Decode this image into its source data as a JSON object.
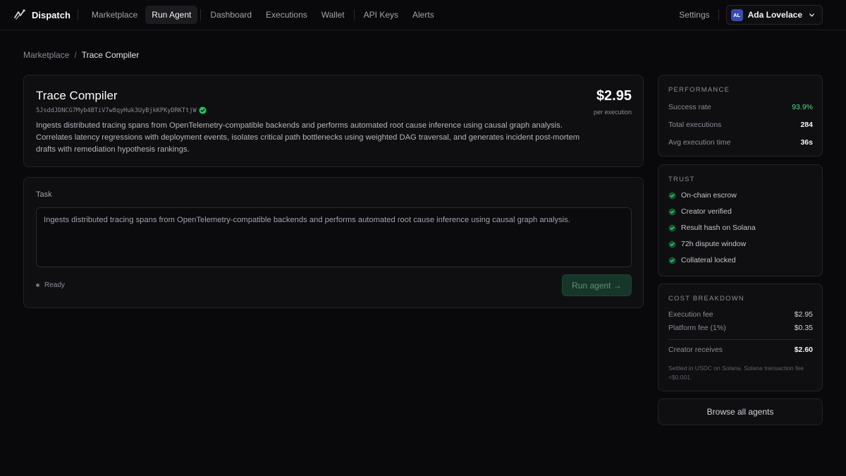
{
  "brand": {
    "name": "Dispatch"
  },
  "nav": {
    "items": [
      "Marketplace",
      "Run Agent",
      "Dashboard",
      "Executions",
      "Wallet",
      "API Keys",
      "Alerts"
    ],
    "active": "Run Agent",
    "settings": "Settings",
    "user": {
      "initials": "AL",
      "name": "Ada Lovelace"
    }
  },
  "breadcrumb": {
    "parent": "Marketplace",
    "separator": "/",
    "current": "Trace Compiler"
  },
  "agent": {
    "title": "Trace Compiler",
    "address": "5JsddJDNCG7Myb4BTiV7w8qyHuk3UyBjkKPKyDRKTtjW",
    "description": "Ingests distributed tracing spans from OpenTelemetry-compatible backends and performs automated root cause inference using causal graph analysis. Correlates latency regressions with deployment events, isolates critical path bottlenecks using weighted DAG traversal, and generates incident post-mortem drafts with remediation hypothesis rankings.",
    "price": "$2.95",
    "price_unit": "per execution"
  },
  "task": {
    "label": "Task",
    "value": "Ingests distributed tracing spans from OpenTelemetry-compatible backends and performs automated root cause inference using causal graph analysis.",
    "status": "Ready",
    "run_label": "Run agent →"
  },
  "performance": {
    "heading": "PERFORMANCE",
    "rows": [
      {
        "label": "Success rate",
        "value": "93.9%"
      },
      {
        "label": "Total executions",
        "value": "284"
      },
      {
        "label": "Avg execution time",
        "value": "36s"
      }
    ]
  },
  "trust": {
    "heading": "TRUST",
    "items": [
      "On-chain escrow",
      "Creator verified",
      "Result hash on Solana",
      "72h dispute window",
      "Collateral locked"
    ]
  },
  "cost": {
    "heading": "COST BREAKDOWN",
    "rows": [
      {
        "label": "Execution fee",
        "value": "$2.95"
      },
      {
        "label": "Platform fee (1%)",
        "value": "$0.35"
      }
    ],
    "total": {
      "label": "Creator receives",
      "value": "$2.60"
    },
    "note": "Settled in USDC on Solana. Solana transaction fee <$0.001."
  },
  "browse_label": "Browse all agents",
  "colors": {
    "accent_green": "#4ade80",
    "run_button_bg": "#16362a",
    "avatar_bg": "#3a4bb3"
  }
}
